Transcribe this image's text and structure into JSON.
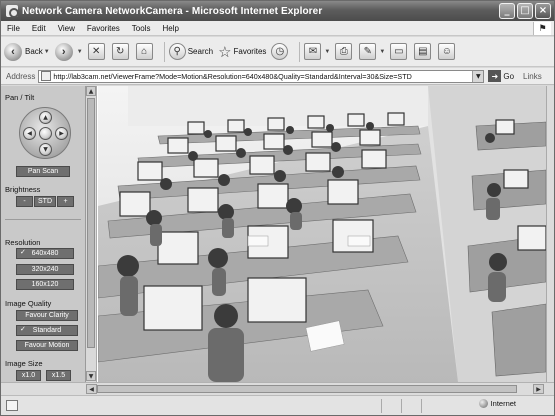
{
  "window": {
    "title": "Network Camera NetworkCamera - Microsoft Internet Explorer",
    "controls": {
      "minimize": "_",
      "maximize": "□",
      "close": "×"
    }
  },
  "menu": [
    "File",
    "Edit",
    "View",
    "Favorites",
    "Tools",
    "Help"
  ],
  "toolbar": {
    "back_label": "Back",
    "search_label": "Search",
    "favorites_label": "Favorites"
  },
  "address": {
    "label": "Address",
    "url": "http://lab3cam.net/ViewerFrame?Mode=Motion&Resolution=640x480&Quality=Standard&Interval=30&Size=STD",
    "go_label": "Go",
    "links_label": "Links"
  },
  "panel": {
    "pan_tilt_label": "Pan / Tilt",
    "pan_scan_label": "Pan Scan",
    "brightness_label": "Brightness",
    "brightness_minus": "-",
    "brightness_std": "STD",
    "brightness_plus": "+",
    "resolution_label": "Resolution",
    "resolutions": [
      "640x480",
      "320x240",
      "160x120"
    ],
    "resolution_selected": "640x480",
    "quality_label": "Image Quality",
    "quality_options": [
      "Favour Clarity",
      "Standard",
      "Favour Motion"
    ],
    "quality_selected": "Standard",
    "size_label": "Image Size",
    "size_options": [
      "x1.0",
      "x1.5"
    ]
  },
  "status": {
    "zone": "Internet"
  },
  "icons": {
    "app": "ie-icon",
    "back": "back-arrow-icon",
    "forward": "forward-arrow-icon",
    "stop": "stop-icon",
    "refresh": "refresh-icon",
    "home": "home-icon",
    "search": "search-icon",
    "favorites": "star-icon",
    "history": "history-icon",
    "mail": "mail-icon",
    "print": "print-icon",
    "edit": "edit-icon",
    "discuss": "discuss-icon",
    "messenger": "messenger-icon"
  }
}
